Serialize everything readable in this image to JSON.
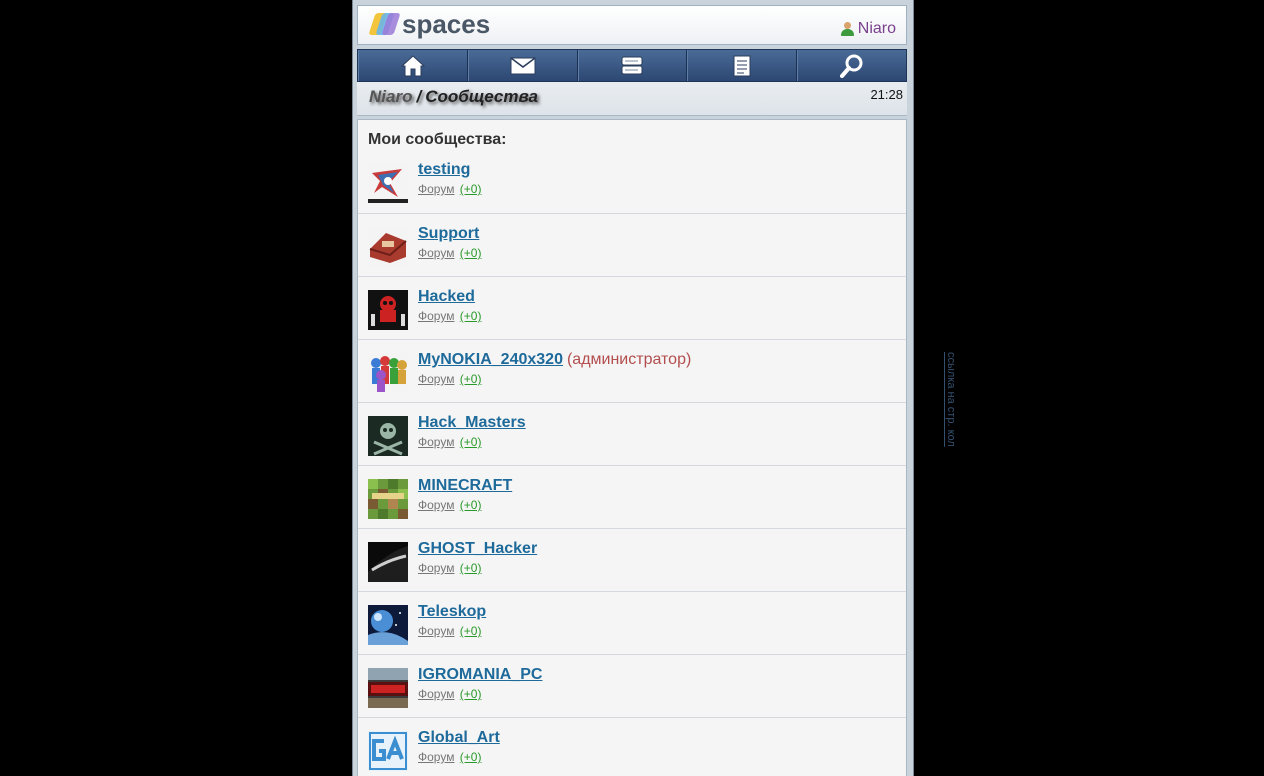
{
  "header": {
    "logo_text": "spaces",
    "username": "Niaro"
  },
  "nav": [
    {
      "name": "home-icon"
    },
    {
      "name": "mail-icon"
    },
    {
      "name": "chat-icon"
    },
    {
      "name": "journal-icon"
    },
    {
      "name": "search-icon"
    }
  ],
  "breadcrumb": {
    "user": "Niaro",
    "separator": "/",
    "section": "Сообщества"
  },
  "clock": "21:28",
  "section_title": "Мои сообщества:",
  "communities": [
    {
      "name": "testing",
      "role": "",
      "forum": "Форум",
      "count": "(+0)"
    },
    {
      "name": "Support",
      "role": "",
      "forum": "Форум",
      "count": "(+0)"
    },
    {
      "name": "Hacked",
      "role": "",
      "forum": "Форум",
      "count": "(+0)"
    },
    {
      "name": "MyNOKIA_240x320",
      "role": "(администратор)",
      "forum": "Форум",
      "count": "(+0)"
    },
    {
      "name": "Hack_Masters",
      "role": "",
      "forum": "Форум",
      "count": "(+0)"
    },
    {
      "name": "MINECRAFT",
      "role": "",
      "forum": "Форум",
      "count": "(+0)"
    },
    {
      "name": "GHOST_Hacker",
      "role": "",
      "forum": "Форум",
      "count": "(+0)"
    },
    {
      "name": "Teleskop",
      "role": "",
      "forum": "Форум",
      "count": "(+0)"
    },
    {
      "name": "IGROMANIA_PC",
      "role": "",
      "forum": "Форум",
      "count": "(+0)"
    },
    {
      "name": "Global_Art",
      "role": "",
      "forum": "Форум",
      "count": "(+0)"
    }
  ],
  "side_link": "ссылка на стр. кол",
  "colors": {
    "link": "#1d6a9b",
    "role": "#b34e4e",
    "count": "#2a9a2a",
    "nav_bg": "#2c4772",
    "username": "#7a3f8f"
  }
}
